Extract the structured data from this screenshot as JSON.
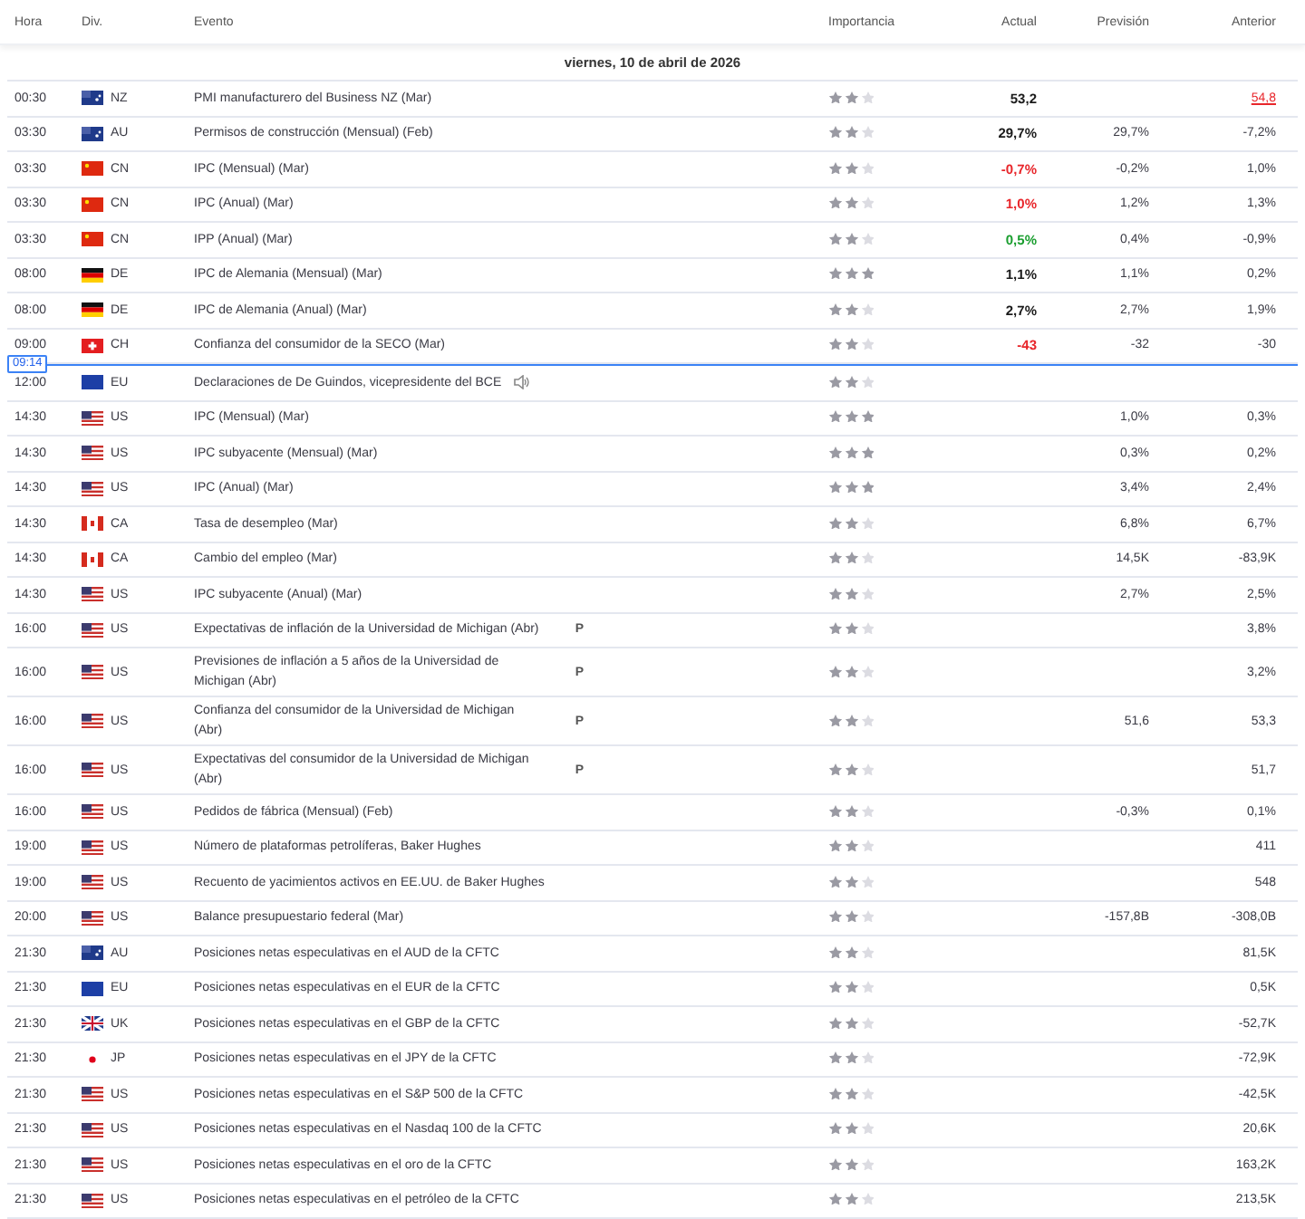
{
  "columns": [
    "Hora",
    "Div.",
    "Evento",
    "Importancia",
    "Actual",
    "Previsión",
    "Anterior"
  ],
  "date": "viernes, 10 de abril de 2026",
  "rows": [
    {
      "kind": "event",
      "time": "00:30",
      "flag": {
        "kind": "au"
      },
      "currency": "NZ",
      "event": "PMI manufacturero del Business NZ (Mar)",
      "speech": false,
      "stars": 2,
      "actual": {
        "value": "53,2",
        "color": "#1a1a1a"
      },
      "previous": "54,8",
      "previous_revised": true
    },
    {
      "kind": "event",
      "time": "03:30",
      "flag": {
        "kind": "au"
      },
      "currency": "AU",
      "event": "Permisos de construcción (Mensual) (Feb)",
      "speech": false,
      "stars": 2,
      "actual": {
        "value": "29,7%",
        "color": "#1a1a1a"
      },
      "forecast": "29,7%",
      "previous": "-7,2%",
      "previous_revised": false
    },
    {
      "kind": "event",
      "time": "03:30",
      "flag": {
        "kind": "cn"
      },
      "currency": "CN",
      "event": "IPC (Mensual) (Mar)",
      "speech": false,
      "stars": 2,
      "actual": {
        "value": "-0,7%",
        "color": "#e8262b"
      },
      "forecast": "-0,2%",
      "previous": "1,0%",
      "previous_revised": false
    },
    {
      "kind": "event",
      "time": "03:30",
      "flag": {
        "kind": "cn"
      },
      "currency": "CN",
      "event": "IPC (Anual) (Mar)",
      "speech": false,
      "stars": 2,
      "actual": {
        "value": "1,0%",
        "color": "#e8262b"
      },
      "forecast": "1,2%",
      "previous": "1,3%",
      "previous_revised": false
    },
    {
      "kind": "event",
      "time": "03:30",
      "flag": {
        "kind": "cn"
      },
      "currency": "CN",
      "event": "IPP (Anual) (Mar)",
      "speech": false,
      "stars": 2,
      "actual": {
        "value": "0,5%",
        "color": "#1a9e2f"
      },
      "forecast": "0,4%",
      "previous": "-0,9%",
      "previous_revised": false
    },
    {
      "kind": "event",
      "time": "08:00",
      "flag": {
        "kind": "de"
      },
      "currency": "DE",
      "event": "IPC de Alemania (Mensual) (Mar)",
      "speech": false,
      "stars": 3,
      "actual": {
        "value": "1,1%",
        "color": "#1a1a1a"
      },
      "forecast": "1,1%",
      "previous": "0,2%",
      "previous_revised": false
    },
    {
      "kind": "event",
      "time": "08:00",
      "flag": {
        "kind": "de"
      },
      "currency": "DE",
      "event": "IPC de Alemania (Anual) (Mar)",
      "speech": false,
      "stars": 2,
      "actual": {
        "value": "2,7%",
        "color": "#1a1a1a"
      },
      "forecast": "2,7%",
      "previous": "1,9%",
      "previous_revised": false
    },
    {
      "kind": "event",
      "time": "09:00",
      "flag": {
        "kind": "ch"
      },
      "currency": "CH",
      "event": "Confianza del consumidor de la SECO (Mar)",
      "speech": false,
      "stars": 2,
      "actual": {
        "value": "-43",
        "color": "#e8262b"
      },
      "forecast": "-32",
      "previous": "-30",
      "previous_revised": false
    },
    {
      "kind": "now",
      "time": "09:14"
    },
    {
      "kind": "event",
      "time": "12:00",
      "flag": {
        "kind": "eu"
      },
      "currency": "EU",
      "event": "Declaraciones de De Guindos, vicepresidente del BCE",
      "speech": true,
      "stars": 2
    },
    {
      "kind": "event",
      "time": "14:30",
      "flag": {
        "kind": "us"
      },
      "currency": "US",
      "event": "IPC (Mensual) (Mar)",
      "speech": false,
      "stars": 3,
      "forecast": "1,0%",
      "previous": "0,3%",
      "previous_revised": false
    },
    {
      "kind": "event",
      "time": "14:30",
      "flag": {
        "kind": "us"
      },
      "currency": "US",
      "event": "IPC subyacente (Mensual) (Mar)",
      "speech": false,
      "stars": 3,
      "forecast": "0,3%",
      "previous": "0,2%",
      "previous_revised": false
    },
    {
      "kind": "event",
      "time": "14:30",
      "flag": {
        "kind": "us"
      },
      "currency": "US",
      "event": "IPC (Anual) (Mar)",
      "speech": false,
      "stars": 3,
      "forecast": "3,4%",
      "previous": "2,4%",
      "previous_revised": false
    },
    {
      "kind": "event",
      "time": "14:30",
      "flag": {
        "kind": "ca"
      },
      "currency": "CA",
      "event": "Tasa de desempleo (Mar)",
      "speech": false,
      "stars": 2,
      "forecast": "6,8%",
      "previous": "6,7%",
      "previous_revised": false
    },
    {
      "kind": "event",
      "time": "14:30",
      "flag": {
        "kind": "ca"
      },
      "currency": "CA",
      "event": "Cambio del empleo (Mar)",
      "speech": false,
      "stars": 2,
      "forecast": "14,5K",
      "previous": "-83,9K",
      "previous_revised": false
    },
    {
      "kind": "event",
      "time": "14:30",
      "flag": {
        "kind": "us"
      },
      "currency": "US",
      "event": "IPC subyacente (Anual) (Mar)",
      "speech": false,
      "stars": 2,
      "forecast": "2,7%",
      "previous": "2,5%",
      "previous_revised": false
    },
    {
      "kind": "event",
      "time": "16:00",
      "flag": {
        "kind": "us"
      },
      "currency": "US",
      "event": "Expectativas de inflación de la Universidad de Michigan (Abr)",
      "mark": "P",
      "speech": false,
      "stars": 2,
      "previous": "3,8%",
      "previous_revised": false
    },
    {
      "kind": "event",
      "time": "16:00",
      "flag": {
        "kind": "us"
      },
      "currency": "US",
      "event": "Previsiones de inflación a 5 años de la Universidad de Michigan (Abr)",
      "mark": "P",
      "speech": false,
      "stars": 2,
      "previous": "3,2%",
      "previous_revised": false
    },
    {
      "kind": "event",
      "time": "16:00",
      "flag": {
        "kind": "us"
      },
      "currency": "US",
      "event": "Confianza del consumidor de la Universidad de Michigan (Abr)",
      "mark": "P",
      "speech": false,
      "stars": 2,
      "forecast": "51,6",
      "previous": "53,3",
      "previous_revised": false
    },
    {
      "kind": "event",
      "time": "16:00",
      "flag": {
        "kind": "us"
      },
      "currency": "US",
      "event": "Expectativas del consumidor de la Universidad de Michigan (Abr)",
      "mark": "P",
      "speech": false,
      "stars": 2,
      "previous": "51,7",
      "previous_revised": false
    },
    {
      "kind": "event",
      "time": "16:00",
      "flag": {
        "kind": "us"
      },
      "currency": "US",
      "event": "Pedidos de fábrica (Mensual) (Feb)",
      "speech": false,
      "stars": 2,
      "forecast": "-0,3%",
      "previous": "0,1%",
      "previous_revised": false
    },
    {
      "kind": "event",
      "time": "19:00",
      "flag": {
        "kind": "us"
      },
      "currency": "US",
      "event": "Número de plataformas petrolíferas, Baker Hughes",
      "speech": false,
      "stars": 2,
      "previous": "411",
      "previous_revised": false
    },
    {
      "kind": "event",
      "time": "19:00",
      "flag": {
        "kind": "us"
      },
      "currency": "US",
      "event": "Recuento de yacimientos activos en EE.UU. de Baker Hughes",
      "speech": false,
      "stars": 2,
      "previous": "548",
      "previous_revised": false
    },
    {
      "kind": "event",
      "time": "20:00",
      "flag": {
        "kind": "us"
      },
      "currency": "US",
      "event": "Balance presupuestario federal (Mar)",
      "speech": false,
      "stars": 2,
      "forecast": "-157,8B",
      "previous": "-308,0B",
      "previous_revised": false
    },
    {
      "kind": "event",
      "time": "21:30",
      "flag": {
        "kind": "au"
      },
      "currency": "AU",
      "event": "Posiciones netas especulativas en el AUD de la CFTC",
      "speech": false,
      "stars": 2,
      "previous": "81,5K",
      "previous_revised": false
    },
    {
      "kind": "event",
      "time": "21:30",
      "flag": {
        "kind": "eu"
      },
      "currency": "EU",
      "event": "Posiciones netas especulativas en el EUR de la CFTC",
      "speech": false,
      "stars": 2,
      "previous": "0,5K",
      "previous_revised": false
    },
    {
      "kind": "event",
      "time": "21:30",
      "flag": {
        "kind": "uk"
      },
      "currency": "UK",
      "event": "Posiciones netas especulativas en el GBP de la CFTC",
      "speech": false,
      "stars": 2,
      "previous": "-52,7K",
      "previous_revised": false
    },
    {
      "kind": "event",
      "time": "21:30",
      "flag": {
        "kind": "jp"
      },
      "currency": "JP",
      "event": "Posiciones netas especulativas en el JPY de la CFTC",
      "speech": false,
      "stars": 2,
      "previous": "-72,9K",
      "previous_revised": false
    },
    {
      "kind": "event",
      "time": "21:30",
      "flag": {
        "kind": "us"
      },
      "currency": "US",
      "event": "Posiciones netas especulativas en el S&P 500 de la CFTC",
      "speech": false,
      "stars": 2,
      "previous": "-42,5K",
      "previous_revised": false
    },
    {
      "kind": "event",
      "time": "21:30",
      "flag": {
        "kind": "us"
      },
      "currency": "US",
      "event": "Posiciones netas especulativas en el Nasdaq 100 de la CFTC",
      "speech": false,
      "stars": 2,
      "previous": "20,6K",
      "previous_revised": false
    },
    {
      "kind": "event",
      "time": "21:30",
      "flag": {
        "kind": "us"
      },
      "currency": "US",
      "event": "Posiciones netas especulativas en el oro de la CFTC",
      "speech": false,
      "stars": 2,
      "previous": "163,2K",
      "previous_revised": false
    },
    {
      "kind": "event",
      "time": "21:30",
      "flag": {
        "kind": "us"
      },
      "currency": "US",
      "event": "Posiciones netas especulativas en el petróleo de la CFTC",
      "speech": false,
      "stars": 2,
      "previous": "213,5K",
      "previous_revised": false
    }
  ]
}
